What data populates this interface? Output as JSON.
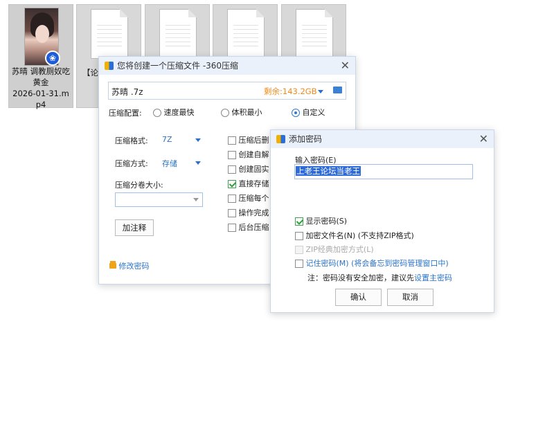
{
  "desktop": {
    "tiles": [
      {
        "name": "苏晴  调教厕奴吃黄金\n2026-01-31.mp4"
      },
      {
        "name": ""
      },
      {
        "name": ""
      },
      {
        "name": ""
      },
      {
        "name": ""
      }
    ],
    "partial_label": "【论"
  },
  "compress_dialog": {
    "title": "您将创建一个压缩文件 -360压缩",
    "filename": "苏晴 .7z",
    "free_space": "剩余:143.2GB",
    "config_label": "压缩配置:",
    "radio_options": [
      "速度最快",
      "体积最小",
      "自定义"
    ],
    "format_label": "压缩格式:",
    "format_value": "7Z",
    "method_label": "压缩方式:",
    "method_value": "存储",
    "volume_label": "压缩分卷大小:",
    "volume_value": "",
    "comment_button": "加注释",
    "options": [
      {
        "label": "压缩后删",
        "checked": false
      },
      {
        "label": "创建自解",
        "checked": false
      },
      {
        "label": "创建固实",
        "checked": false
      },
      {
        "label": "直接存储",
        "checked": true
      },
      {
        "label": "压缩每个",
        "checked": false
      },
      {
        "label": "操作完成",
        "checked": false
      },
      {
        "label": "后台压缩",
        "checked": false
      }
    ],
    "change_password_link": "修改密码"
  },
  "password_dialog": {
    "title": "添加密码",
    "input_label": "输入密码(E)",
    "password_value": "上老王论坛当老王",
    "show_password": "显示密码(S)",
    "encrypt_filenames": "加密文件名(N) (不支持ZIP格式)",
    "zip_classic": "ZIP经典加密方式(L)",
    "remember_password": "记住密码(M) (将会备忘到密码管理窗口中)",
    "note_prefix": "注：密码没有安全加密，建议先",
    "note_link": "设置主密码",
    "ok_button": "确认",
    "cancel_button": "取消"
  },
  "colors": {
    "accent": "#2a73c9",
    "free_space": "#f08a1a",
    "titlebar": "#eaf1fb"
  }
}
